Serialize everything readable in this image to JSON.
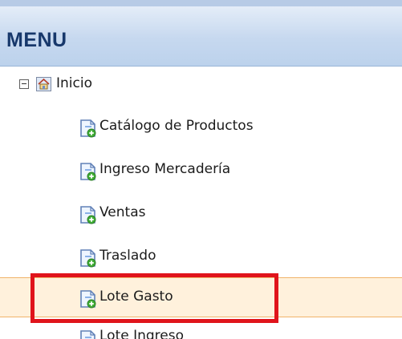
{
  "panel": {
    "title": "MENU"
  },
  "tree": {
    "root": {
      "label": "Inicio",
      "expanded": true
    },
    "items": [
      {
        "label": "Catálogo de Productos"
      },
      {
        "label": "Ingreso Mercadería"
      },
      {
        "label": "Ventas"
      },
      {
        "label": "Traslado"
      },
      {
        "label": "Lote Gasto",
        "selected": true
      },
      {
        "label": "Lote Ingreso"
      }
    ]
  },
  "icons": {
    "toggle": "collapse-icon",
    "root": "home-icon",
    "item": "add-document-icon"
  },
  "colors": {
    "header_text": "#17386b",
    "selection_background": "#fff1dc",
    "selection_border": "#f0b36a",
    "annotation": "#e0141b"
  }
}
